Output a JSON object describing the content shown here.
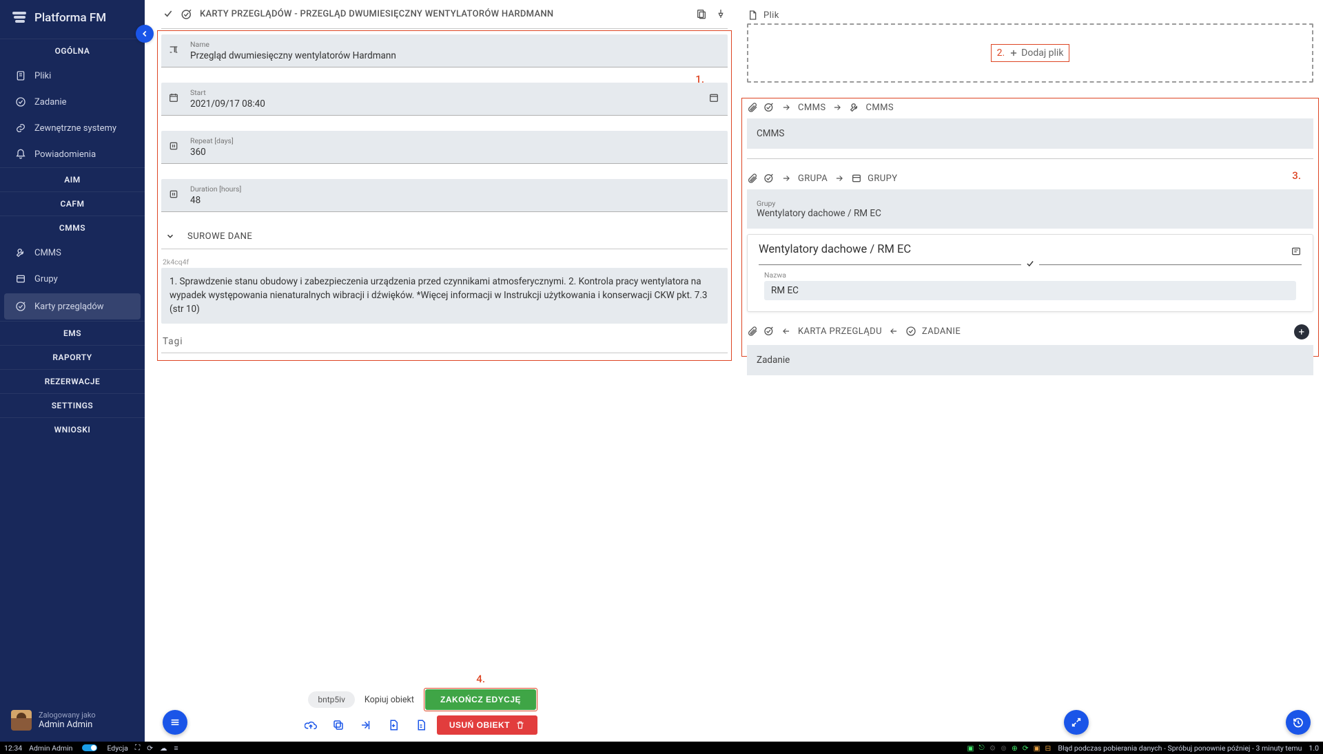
{
  "app": {
    "title": "Platforma FM"
  },
  "sidebar": {
    "sections": [
      {
        "caption": "OGÓLNA",
        "items": [
          {
            "icon": "file-icon",
            "label": "Pliki"
          },
          {
            "icon": "check-circle-icon",
            "label": "Zadanie"
          },
          {
            "icon": "link-icon",
            "label": "Zewnętrzne systemy"
          },
          {
            "icon": "bell-icon",
            "label": "Powiadomienia"
          }
        ]
      },
      {
        "caption": "AIM",
        "items": []
      },
      {
        "caption": "CAFM",
        "items": []
      },
      {
        "caption": "CMMS",
        "items": [
          {
            "icon": "wrench-icon",
            "label": "CMMS"
          },
          {
            "icon": "group-icon",
            "label": "Grupy"
          },
          {
            "icon": "checklist-icon",
            "label": "Karty przeglądów",
            "active": true
          }
        ]
      },
      {
        "caption": "EMS",
        "items": []
      },
      {
        "caption": "RAPORTY",
        "items": []
      },
      {
        "caption": "REZERWACJE",
        "items": []
      },
      {
        "caption": "SETTINGS",
        "items": []
      },
      {
        "caption": "WNIOSKI",
        "items": []
      }
    ],
    "user": {
      "logged_as_label": "Zalogowany jako",
      "name": "Admin Admin"
    }
  },
  "left": {
    "breadcrumb_title": "KARTY PRZEGLĄDÓW - PRZEGLĄD DWUMIESIĘCZNY WENTYLATORÓW HARDMANN",
    "fields": {
      "name": {
        "label": "Name",
        "value": "Przegląd dwumiesięczny wentylatorów Hardmann"
      },
      "start": {
        "label": "Start",
        "value": "2021/09/17 08:40"
      },
      "repeat": {
        "label": "Repeat [days]",
        "value": "360"
      },
      "duration": {
        "label": "Duration [hours]",
        "value": "48"
      }
    },
    "raw_header": "SUROWE DANE",
    "object_id": "2k4cq4f",
    "raw_body": "1. Sprawdzenie stanu obudowy i zabezpieczenia urządzenia przed czynnikami atmosferycznymi. 2. Kontrola pracy wentylatora na wypadek występowania nienaturalnych wibracji i dźwięków. *Więcej informacji w Instrukcji użytkowania i konserwacji CKW pkt. 7.3 (str 10)",
    "tags_label": "Tagi",
    "annot1": "1."
  },
  "right": {
    "file": {
      "header": "Plik",
      "add_label": "Dodaj plik",
      "annot": "2."
    },
    "cmms": {
      "crumb_a": "CMMS",
      "crumb_b": "CMMS",
      "strip": "CMMS"
    },
    "grupa": {
      "crumb_a": "GRUPA",
      "crumb_b": "GRUPY",
      "grupy_label": "Grupy",
      "grupy_value": "Wentylatory dachowe / RM EC",
      "card_title": "Wentylatory dachowe / RM EC",
      "nazwa_label": "Nazwa",
      "nazwa_value": "RM EC"
    },
    "annot3": "3.",
    "zad": {
      "crumb_a": "KARTA PRZEGLĄDU",
      "crumb_b": "ZADANIE",
      "strip": "Zadanie"
    }
  },
  "actions": {
    "obj_code": "bntp5iv",
    "copy": "Kopiuj obiekt",
    "finish": "ZAKOŃCZ EDYCJĘ",
    "delete": "USUŃ OBIEKT",
    "annot4": "4."
  },
  "statusbar": {
    "time": "12:34",
    "user": "Admin Admin",
    "mode": "Edycja",
    "error": "Błąd podczas pobierania danych - Spróbuj ponownie później - 3 minuty temu",
    "version": "1.0"
  }
}
